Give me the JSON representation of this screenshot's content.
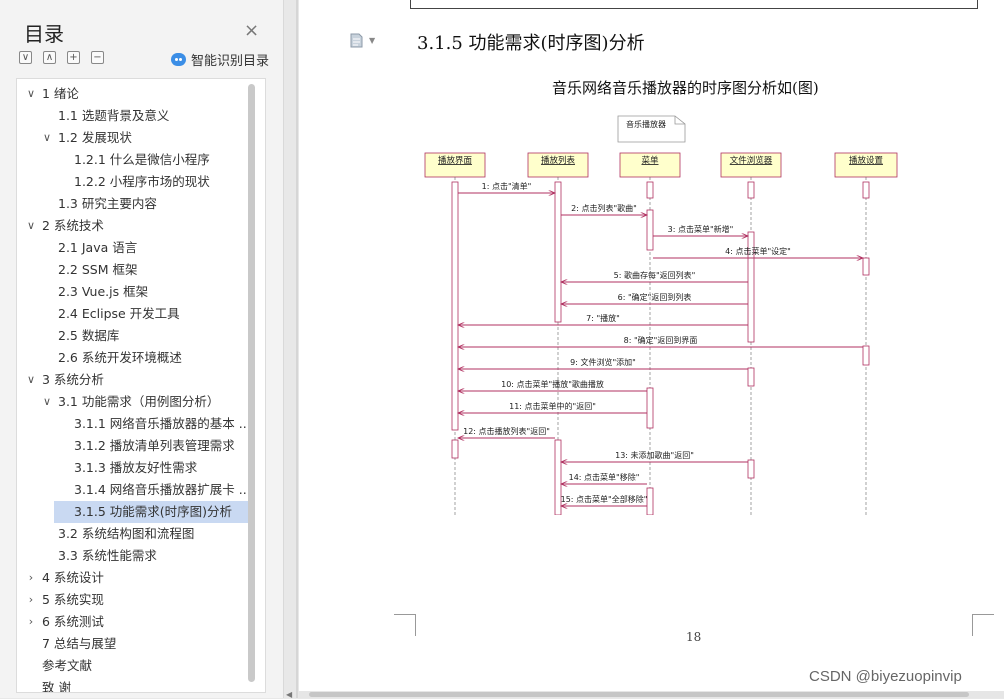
{
  "sidebar": {
    "title": "目录",
    "close_symbol": "×",
    "toolbar": [
      "∨",
      "∧",
      "+",
      "−"
    ],
    "toolbar_icons": [
      "collapse-all-icon",
      "expand-icon",
      "add-heading-icon",
      "remove-heading-icon"
    ],
    "smart_label": "智能识别目录",
    "smart_icon": "robot-icon",
    "items": [
      {
        "label": "1 绪论",
        "level": 0,
        "chevron": "∨"
      },
      {
        "label": "1.1 选题背景及意义",
        "level": 1,
        "chevron": ""
      },
      {
        "label": "1.2 发展现状",
        "level": 1,
        "chevron": "∨"
      },
      {
        "label": "1.2.1 什么是微信小程序",
        "level": 2,
        "chevron": ""
      },
      {
        "label": "1.2.2 小程序市场的现状",
        "level": 2,
        "chevron": ""
      },
      {
        "label": "1.3 研究主要内容",
        "level": 1,
        "chevron": ""
      },
      {
        "label": "2 系统技术",
        "level": 0,
        "chevron": "∨"
      },
      {
        "label": "2.1 Java 语言",
        "level": 1,
        "chevron": ""
      },
      {
        "label": "2.2 SSM 框架",
        "level": 1,
        "chevron": ""
      },
      {
        "label": "2.3 Vue.js 框架",
        "level": 1,
        "chevron": ""
      },
      {
        "label": "2.4 Eclipse 开发工具",
        "level": 1,
        "chevron": ""
      },
      {
        "label": "2.5 数据库",
        "level": 1,
        "chevron": ""
      },
      {
        "label": "2.6 系统开发环境概述",
        "level": 1,
        "chevron": ""
      },
      {
        "label": "3 系统分析",
        "level": 0,
        "chevron": "∨"
      },
      {
        "label": "3.1  功能需求（用例图分析）",
        "level": 1,
        "chevron": "∨"
      },
      {
        "label": "3.1.1  网络音乐播放器的基本 ...",
        "level": 2,
        "chevron": ""
      },
      {
        "label": "3.1.2  播放清单列表管理需求",
        "level": 2,
        "chevron": ""
      },
      {
        "label": "3.1.3  播放友好性需求",
        "level": 2,
        "chevron": ""
      },
      {
        "label": "3.1.4  网络音乐播放器扩展卡 ...",
        "level": 2,
        "chevron": ""
      },
      {
        "label": "3.1.5  功能需求(时序图)分析",
        "level": 2,
        "chevron": "",
        "active": true
      },
      {
        "label": "3.2  系统结构图和流程图",
        "level": 1,
        "chevron": ""
      },
      {
        "label": "3.3  系统性能需求",
        "level": 1,
        "chevron": ""
      },
      {
        "label": "4 系统设计",
        "level": 0,
        "chevron": "›"
      },
      {
        "label": "5 系统实现",
        "level": 0,
        "chevron": "›"
      },
      {
        "label": "6 系统测试",
        "level": 0,
        "chevron": "›"
      },
      {
        "label": "7 总结与展望",
        "level": 0,
        "chevron": ""
      },
      {
        "label": "参考文献",
        "level": 0,
        "chevron": ""
      },
      {
        "label": "致   谢",
        "level": 0,
        "chevron": ""
      }
    ]
  },
  "document": {
    "heading": "3.1.5  功能需求(时序图)分析",
    "caption": "音乐网络音乐播放器的时序图分析如(图)",
    "note_icon": "note-icon",
    "page_number": "18",
    "watermark": "CSDN @biyezuopinvip"
  },
  "diagram": {
    "note": "音乐播放器",
    "lifelines": [
      "播放界面",
      "播放列表",
      "菜单",
      "文件浏览器",
      "播放设置"
    ],
    "messages": [
      {
        "from": 0,
        "to": 1,
        "label": "1: 点击\"清单\""
      },
      {
        "from": 1,
        "to": 2,
        "label": "2: 点击列表\"歌曲\""
      },
      {
        "from": 2,
        "to": 3,
        "label": "3: 点击菜单\"新增\""
      },
      {
        "from": 2,
        "to": 4,
        "label": "4: 点击菜单\"设定\""
      },
      {
        "from": 3,
        "to": 1,
        "label": "5: 歌曲存每\"返回列表\""
      },
      {
        "from": 3,
        "to": 1,
        "label": "6: \"确定\"返回到列表"
      },
      {
        "from": 3,
        "to": 0,
        "label": "7: \"播放\""
      },
      {
        "from": 4,
        "to": 0,
        "label": "8: \"确定\"返回到界面"
      },
      {
        "from": 3,
        "to": 0,
        "label": "9: 文件浏览\"添加\""
      },
      {
        "from": 2,
        "to": 0,
        "label": "10: 点击菜单\"播放\"歌曲播放"
      },
      {
        "from": 2,
        "to": 0,
        "label": "11: 点击菜单中的\"返回\""
      },
      {
        "from": 1,
        "to": 0,
        "label": "12: 点击播放列表\"返回\""
      },
      {
        "from": 3,
        "to": 1,
        "label": "13: 未添加歌曲\"返回\""
      },
      {
        "from": 2,
        "to": 1,
        "label": "14: 点击菜单\"移除\""
      },
      {
        "from": 2,
        "to": 1,
        "label": "15: 点击菜单\"全部移除\""
      }
    ]
  }
}
